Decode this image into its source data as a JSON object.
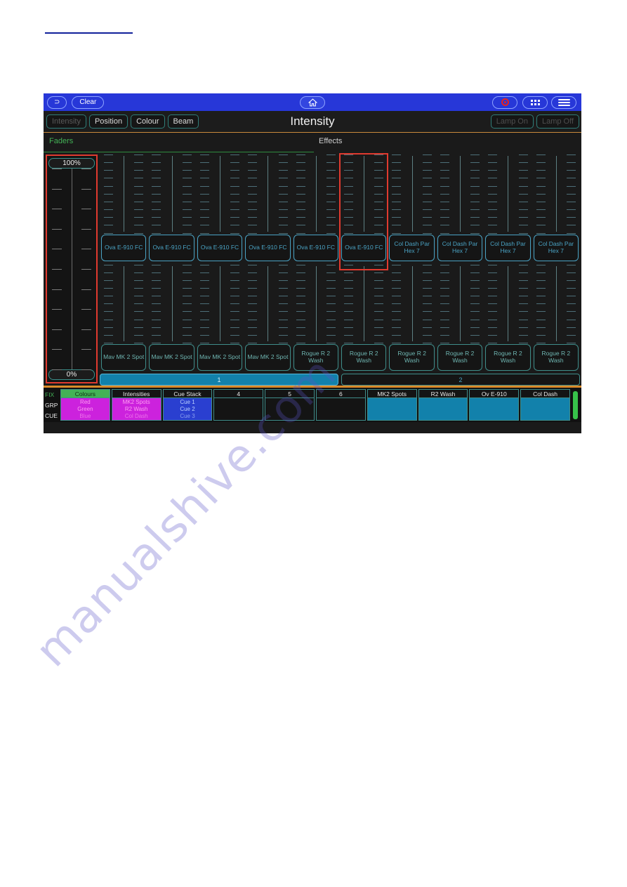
{
  "page": {
    "watermark_text": "manualshive.com"
  },
  "toolbar": {
    "back_label": "⊃",
    "back_icon": "back-arrow-icon",
    "clear_label": "Clear",
    "home_icon": "home-icon",
    "record_icon": "record-icon",
    "grid_icon": "grid-icon",
    "menu_icon": "hamburger-menu-icon"
  },
  "attribute_bar": {
    "title": "Intensity",
    "buttons": [
      {
        "label": "Intensity",
        "state": "selected"
      },
      {
        "label": "Position",
        "state": "normal"
      },
      {
        "label": "Colour",
        "state": "normal"
      },
      {
        "label": "Beam",
        "state": "normal"
      }
    ],
    "lamp_on_label": "Lamp On",
    "lamp_off_label": "Lamp Off"
  },
  "subtabs": {
    "active_label": "Faders",
    "inactive_label": "Effects"
  },
  "fader_scale": {
    "top_label": "100%",
    "bottom_label": "0%",
    "highlighted": true
  },
  "fader_columns": [
    {
      "top_label": "Ova E-910 FC",
      "bottom_label": "Mav MK 2 Spot",
      "selected": false
    },
    {
      "top_label": "Ova E-910 FC",
      "bottom_label": "Mav MK 2 Spot",
      "selected": false
    },
    {
      "top_label": "Ova E-910 FC",
      "bottom_label": "Mav MK 2 Spot",
      "selected": false
    },
    {
      "top_label": "Ova E-910 FC",
      "bottom_label": "Mav MK 2 Spot",
      "selected": false
    },
    {
      "top_label": "Ova E-910 FC",
      "bottom_label": "Rogue R 2 Wash",
      "selected": false
    },
    {
      "top_label": "Ova E-910 FC",
      "bottom_label": "Rogue R 2 Wash",
      "selected": true
    },
    {
      "top_label": "Col Dash Par Hex 7",
      "bottom_label": "Rogue R 2 Wash",
      "selected": false
    },
    {
      "top_label": "Col Dash Par Hex 7",
      "bottom_label": "Rogue R 2 Wash",
      "selected": false
    },
    {
      "top_label": "Col Dash Par Hex 7",
      "bottom_label": "Rogue R 2 Wash",
      "selected": false
    },
    {
      "top_label": "Col Dash Par Hex 7",
      "bottom_label": "Rogue R 2 Wash",
      "selected": false
    }
  ],
  "pages": [
    {
      "label": "1",
      "selected": true
    },
    {
      "label": "2",
      "selected": false
    }
  ],
  "status_bar": {
    "row_labels": [
      "FIX",
      "GRP",
      "CUE"
    ],
    "cells": [
      {
        "header": "Colours",
        "header_style": "green",
        "body_style": "magenta",
        "lines": [
          "Red",
          "Green",
          "Blue"
        ]
      },
      {
        "header": "Intensities",
        "header_style": "dark",
        "body_style": "magenta",
        "lines": [
          "MK2 Spots",
          "R2 Wash",
          "Col Dash"
        ]
      },
      {
        "header": "Cue Stack",
        "header_style": "dark",
        "body_style": "blue",
        "lines": [
          "Cue 1",
          "Cue 2",
          "Cue 3"
        ]
      },
      {
        "header": "4",
        "header_style": "dark",
        "body_style": "dark",
        "lines": []
      },
      {
        "header": "5",
        "header_style": "dark",
        "body_style": "dark",
        "lines": []
      },
      {
        "header": "6",
        "header_style": "dark",
        "body_style": "dark",
        "lines": []
      },
      {
        "header": "MK2 Spots",
        "header_style": "dark",
        "body_style": "cyan",
        "lines": []
      },
      {
        "header": "R2 Wash",
        "header_style": "dark",
        "body_style": "cyan",
        "lines": []
      },
      {
        "header": "Ov E-910",
        "header_style": "dark",
        "body_style": "cyan",
        "lines": []
      },
      {
        "header": "Col Dash",
        "header_style": "dark",
        "body_style": "cyan",
        "lines": []
      }
    ]
  },
  "colors": {
    "toolbar_blue": "#2737d8",
    "accent_orange": "#d98a2a",
    "teal_border": "#3f8d8a",
    "fixture_blue": "#4aa3c4",
    "highlight_red": "#e03a2f",
    "green": "#43b256",
    "magenta": "#cc22dd",
    "cue_blue": "#2a3fd0",
    "cyan_cell": "#1281ab"
  }
}
